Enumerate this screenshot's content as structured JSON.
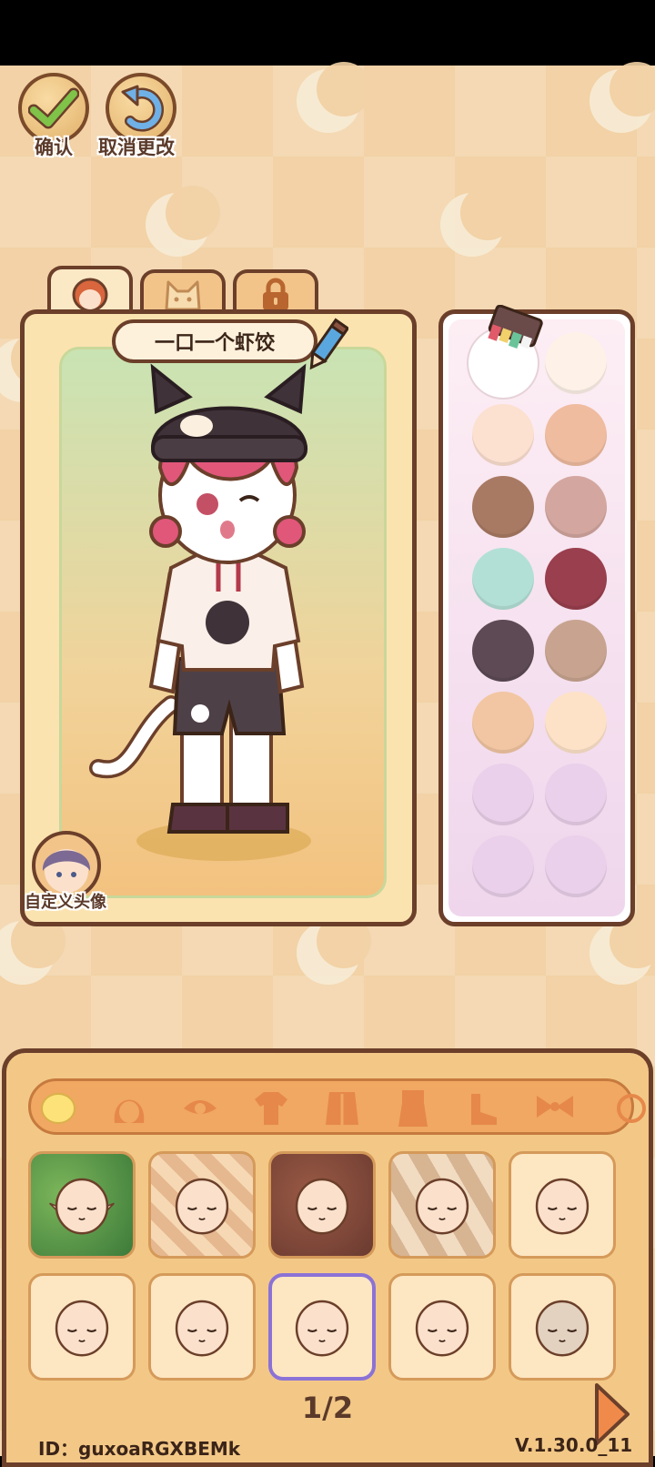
{
  "top_buttons": {
    "confirm_label": "确认",
    "cancel_label": "取消更改"
  },
  "tabs": [
    {
      "icon": "face-icon",
      "active": true
    },
    {
      "icon": "cat-icon",
      "active": false
    },
    {
      "icon": "lock-icon",
      "active": false
    }
  ],
  "character": {
    "name": "一口一个虾饺"
  },
  "avatar_label": "自定义头像",
  "palette": [
    "#ffffff",
    "#fdf1e8",
    "#fce0d0",
    "#efbca0",
    "#a97a63",
    "#d3a79f",
    "#b3e0d6",
    "#9a3f4e",
    "#5d4a55",
    "#c8a490",
    "#f2c6a2",
    "#fde2c8",
    "#ead0ea",
    "#ead0ea",
    "#ead0ea",
    "#ead0ea"
  ],
  "palette_selected_index": 0,
  "categories": [
    "face-icon",
    "hair-icon",
    "eye-icon",
    "shirt-icon",
    "coat-icon",
    "outfit-icon",
    "shoe-icon",
    "bow-icon",
    "accessory-icon"
  ],
  "face_tiles": [
    {
      "bg": "forest",
      "skin": "#fbe1cc",
      "ears": "elf"
    },
    {
      "bg": "argyle",
      "skin": "#fbe1cc"
    },
    {
      "bg": "brown",
      "skin": "#fbe1cc",
      "ears": "none"
    },
    {
      "bg": "diagonal",
      "skin": "#fbe1cc"
    },
    {
      "bg": "plain",
      "skin": "#fbe1cc"
    },
    {
      "bg": "plain",
      "skin": "#fbe1cc"
    },
    {
      "bg": "plain",
      "skin": "#fbe1cc"
    },
    {
      "bg": "plain",
      "skin": "#fbe1cc",
      "selected": true
    },
    {
      "bg": "plain",
      "skin": "#fbe1cc"
    },
    {
      "bg": "plain",
      "skin": "#e4d2c0"
    }
  ],
  "pager": "1/2",
  "footer": {
    "id": "ID：guxoaRGXBEMk",
    "version": "V.1.30.0_11"
  }
}
